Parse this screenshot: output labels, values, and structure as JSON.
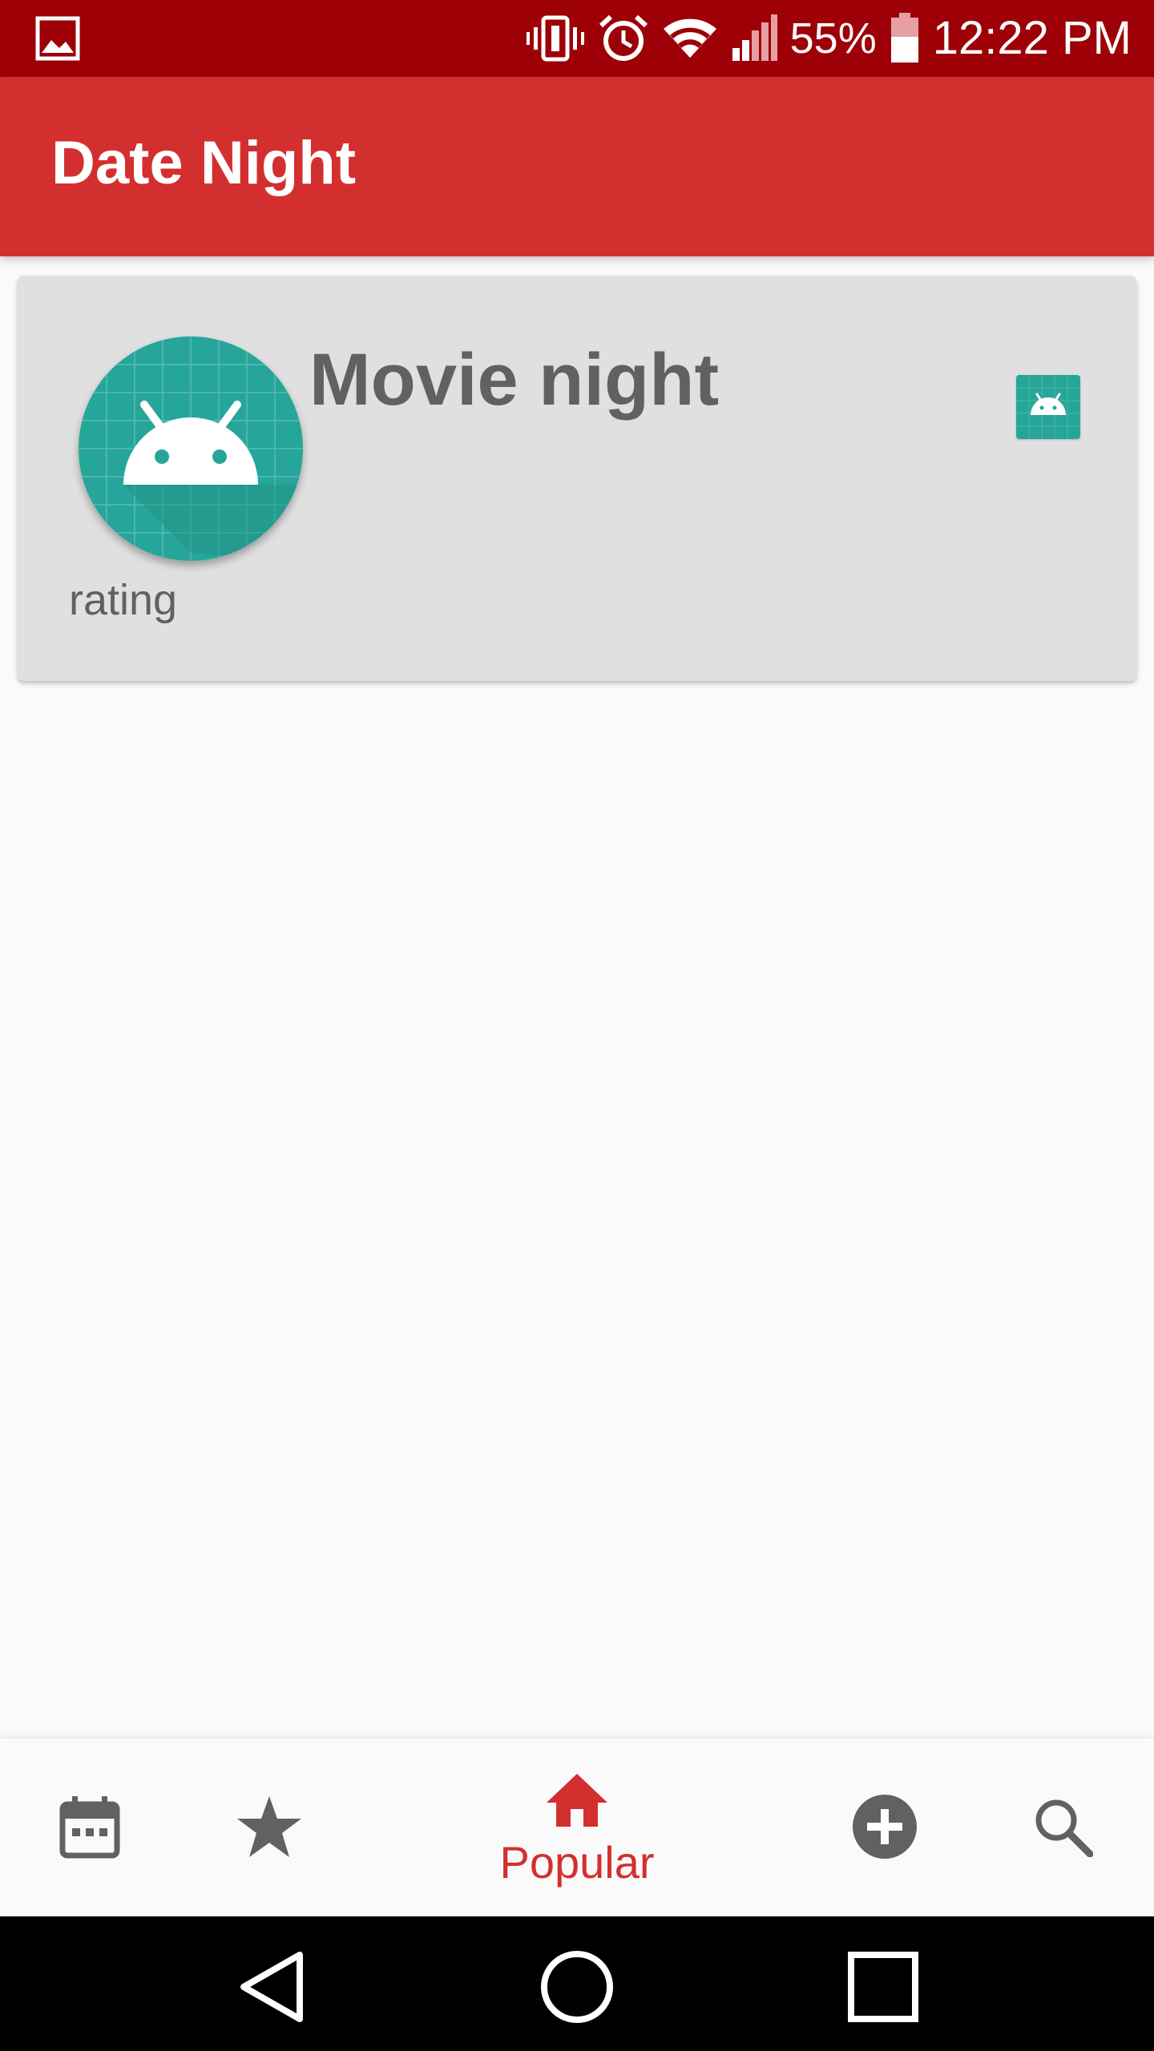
{
  "status_bar": {
    "battery": "55%",
    "time": "12:22 PM",
    "icons": [
      "gallery-icon",
      "vibrate-icon",
      "alarm-icon",
      "wifi-icon",
      "signal-icon",
      "battery-icon"
    ]
  },
  "app_bar": {
    "title": "Date Night"
  },
  "card": {
    "title": "Movie night",
    "rating_label": "rating",
    "avatar_icon": "android-placeholder-icon",
    "thumbnail_icon": "android-placeholder-icon"
  },
  "bottom_nav": {
    "items": [
      {
        "icon": "calendar-icon",
        "label": ""
      },
      {
        "icon": "star-icon",
        "label": ""
      },
      {
        "icon": "home-icon",
        "label": "Popular"
      },
      {
        "icon": "add-circle-icon",
        "label": ""
      },
      {
        "icon": "search-icon",
        "label": ""
      }
    ],
    "active_color": "#d32f2f",
    "inactive_color": "#616161"
  },
  "system_nav": {
    "buttons": [
      "back-icon",
      "home-circle-icon",
      "recents-icon"
    ]
  },
  "colors": {
    "status_bar": "#9d0007",
    "primary": "#d32f2f",
    "card_bg": "#e0e0e0",
    "teal": "#26a69a"
  }
}
